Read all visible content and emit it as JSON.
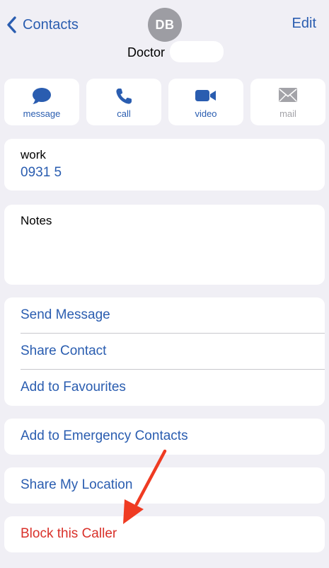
{
  "header": {
    "back_label": "Contacts",
    "edit_label": "Edit",
    "avatar_initials": "DB",
    "contact_name": "Doctor"
  },
  "actions": [
    {
      "label": "message",
      "icon": "message-icon",
      "enabled": true
    },
    {
      "label": "call",
      "icon": "phone-icon",
      "enabled": true
    },
    {
      "label": "video",
      "icon": "video-icon",
      "enabled": true
    },
    {
      "label": "mail",
      "icon": "mail-icon",
      "enabled": false
    }
  ],
  "phone": {
    "label": "work",
    "number": "0931 5"
  },
  "notes": {
    "label": "Notes"
  },
  "options_group": [
    {
      "label": "Send Message"
    },
    {
      "label": "Share Contact"
    },
    {
      "label": "Add to Favourites"
    }
  ],
  "emergency": {
    "label": "Add to Emergency Contacts"
  },
  "location": {
    "label": "Share My Location"
  },
  "block": {
    "label": "Block this Caller"
  },
  "colors": {
    "accent": "#2a5db0",
    "destructive": "#d9312a",
    "background": "#f0eff5",
    "annotation_arrow": "#ef3b22"
  }
}
